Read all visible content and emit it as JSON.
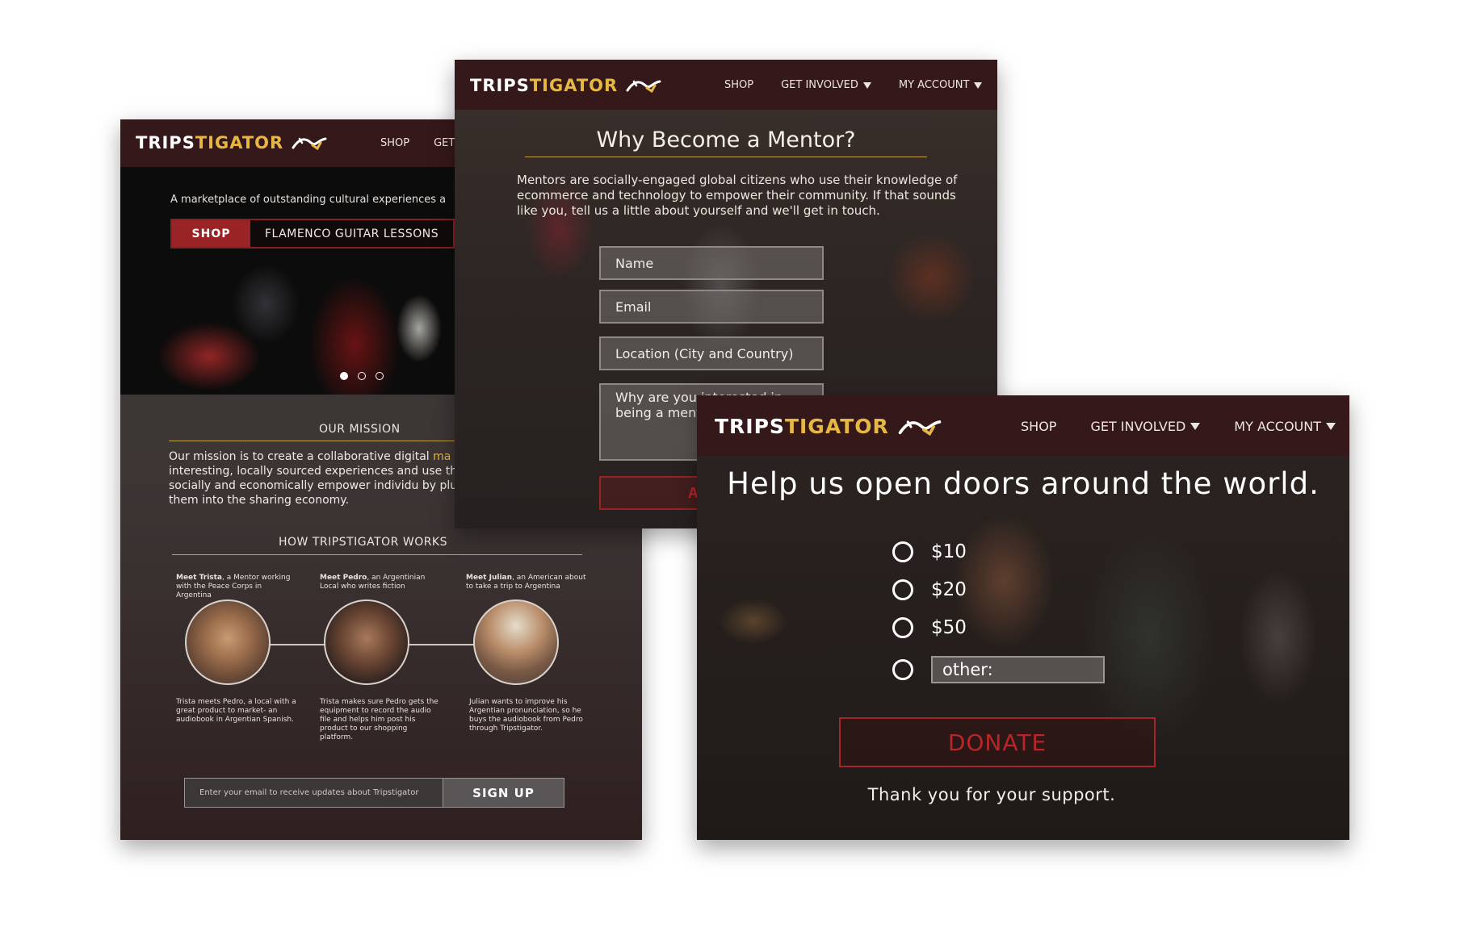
{
  "brand": {
    "logo_part1": "TRIPS",
    "logo_part2": "TIGATOR",
    "colors": {
      "navbar": "#351819",
      "accent_gold": "#e7b744",
      "accent_red": "#9a2326"
    },
    "logo_icon": "gator-logo-icon"
  },
  "home_page": {
    "nav": {
      "shop": "SHOP",
      "get_involved": "GET"
    },
    "hero": {
      "tagline": "A marketplace of outstanding cultural experiences a",
      "shop_button": "SHOP",
      "featured": "FLAMENCO GUITAR LESSONS",
      "carousel_dots": 3,
      "carousel_active": 1
    },
    "mission": {
      "title": "OUR MISSION",
      "text_before": "Our mission is to create a collaborative digital ",
      "text_highlight": "ma",
      "text_after": " interesting, locally sourced experiences and use that socially and economically empower individu by plugging them into the sharing economy."
    },
    "how_it_works": {
      "title": "HOW TRIPSTIGATOR WORKS",
      "people": [
        {
          "name": "Meet Trista",
          "intro": ", a Mentor working with the Peace Corps in Argentina",
          "desc": "Trista meets Pedro, a local with a great product to market- an audiobook in Argentian Spanish."
        },
        {
          "name": "Meet Pedro",
          "intro": ", an Argentinian Local who writes fiction",
          "desc": "Trista makes sure Pedro gets the equipment to record the audio file and helps him post his product to our shopping platform."
        },
        {
          "name": "Meet Julian",
          "intro": ", an American about to take a trip to Argentina",
          "desc": "Julian wants to improve his Argentian pronunciation, so he buys the audiobook from Pedro through Tripstigator."
        }
      ]
    },
    "signup": {
      "placeholder": "Enter your email to receive updates about Tripstigator",
      "button": "SIGN UP"
    }
  },
  "mentor_page": {
    "nav": {
      "shop": "SHOP",
      "get_involved": "GET INVOLVED",
      "my_account": "MY ACCOUNT"
    },
    "title": "Why Become a Mentor?",
    "text": "Mentors are socially-engaged global citizens who use their knowledge of ecommerce and technology to empower their community. If that sounds like you, tell us a little about yourself and we'll get in touch.",
    "fields": {
      "name": "Name",
      "email": "Email",
      "location": "Location (City and Country)",
      "why": "Why are you interested in being a mentor?"
    },
    "submit": "APPLY"
  },
  "donate_page": {
    "nav": {
      "shop": "SHOP",
      "get_involved": "GET INVOLVED",
      "my_account": "MY ACCOUNT"
    },
    "title": "Help us open doors around the world.",
    "options": [
      "$10",
      "$20",
      "$50"
    ],
    "other_placeholder": "other:",
    "donate_button": "DONATE",
    "thanks": "Thank you for your support."
  }
}
